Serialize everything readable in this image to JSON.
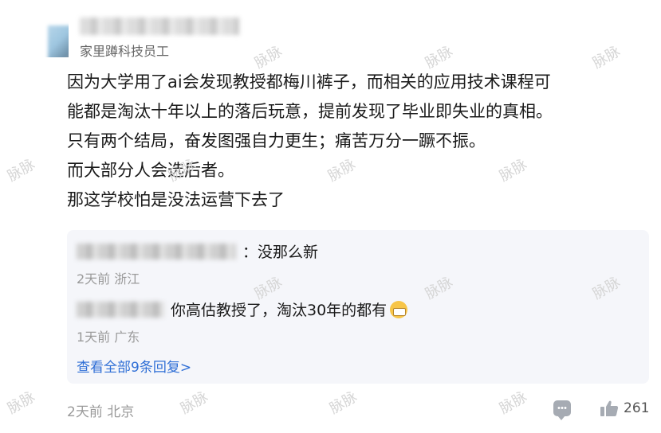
{
  "author": {
    "title": "家里蹲科技员工"
  },
  "post": {
    "lines": [
      "因为大学用了ai会发现教授都梅川裤子，而相关的应用技术课程可",
      "能都是淘汰十年以上的落后玩意，提前发现了毕业即失业的真相。",
      "只有两个结局，奋发图强自力更生；痛苦万分一蹶不振。",
      "而大部分人会选后者。",
      "那这学校怕是没法运营下去了"
    ],
    "meta": "2天前 北京",
    "like_count": "261"
  },
  "replies": [
    {
      "text": "：没那么新",
      "meta": "2天前 浙江"
    },
    {
      "text": "你高估教授了，淘汰30年的都有",
      "meta": "1天前 广东"
    }
  ],
  "view_all_label": "查看全部9条回复>",
  "watermark": "脉脉",
  "icons": [
    "comment-icon",
    "thumbs-up-icon",
    "grimace-emoji"
  ]
}
